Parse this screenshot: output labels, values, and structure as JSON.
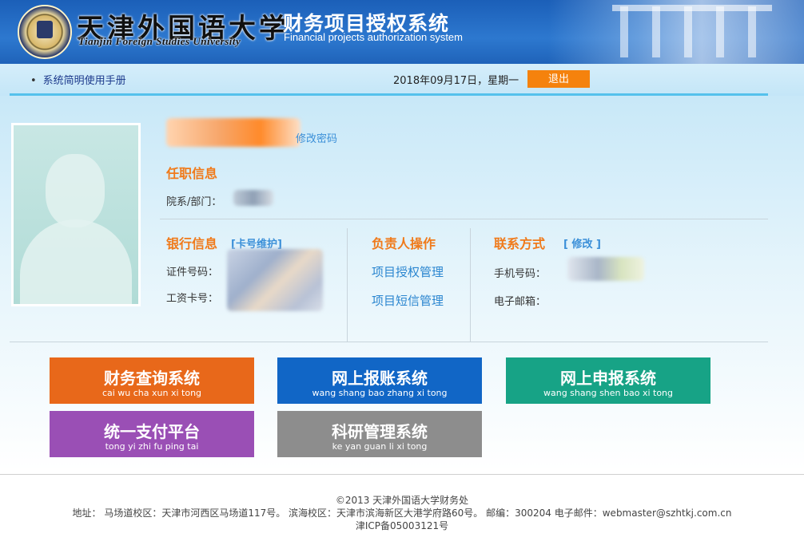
{
  "header": {
    "university_cn": "天津外国语大学",
    "university_en": "Tianjin Foreign Studies University",
    "system_cn": "财务项目授权系统",
    "system_en": "Financial projects authorization system"
  },
  "topbar": {
    "manual_link": "系统简明使用手册",
    "date": "2018年09月17日，星期一",
    "logout": "退出"
  },
  "profile": {
    "change_password": "修改密码",
    "employment_title": "任职信息",
    "department_label": "院系/部门：",
    "bank_title": "银行信息",
    "card_maintenance": "[卡号维护]",
    "id_label": "证件号码：",
    "salary_card_label": "工资卡号：",
    "manager_title": "负责人操作",
    "project_auth": "项目授权管理",
    "project_sms": "项目短信管理",
    "contact_title": "联系方式",
    "contact_edit": "[ 修改 ]",
    "phone_label": "手机号码：",
    "email_label": "电子邮箱："
  },
  "tiles": [
    {
      "cn": "财务查询系统",
      "py": "cai wu cha xun xi tong",
      "color": "#e8681a"
    },
    {
      "cn": "网上报账系统",
      "py": "wang shang bao zhang xi tong",
      "color": "#1166c6"
    },
    {
      "cn": "网上申报系统",
      "py": "wang shang shen bao xi tong",
      "color": "#17a386"
    },
    {
      "cn": "统一支付平台",
      "py": "tong yi zhi fu ping tai",
      "color": "#9a4fb5"
    },
    {
      "cn": "科研管理系统",
      "py": "ke yan guan li xi tong",
      "color": "#8d8d8d"
    }
  ],
  "footer": {
    "copyright": "©2013 天津外国语大学财务处",
    "address": "地址： 马场道校区：天津市河西区马场道117号。 滨海校区：天津市滨海新区大港学府路60号。 邮编：300204 电子邮件：webmaster@szhtkj.com.cn",
    "icp": "津ICP备05003121号"
  }
}
